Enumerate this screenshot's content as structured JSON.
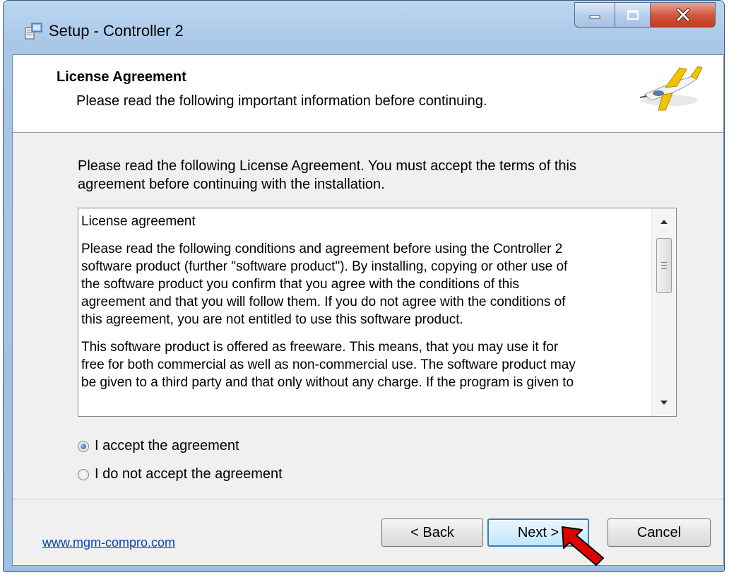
{
  "window": {
    "title": "Setup - Controller 2",
    "caption_buttons": [
      "minimize-icon",
      "maximize-icon",
      "close-icon"
    ]
  },
  "header": {
    "title": "License Agreement",
    "subtitle": "Please read the following important information before continuing.",
    "logo_icon": "airplane-icon"
  },
  "intro_text": "Please read the following License Agreement. You must accept the terms of this agreement before continuing with the installation.",
  "license": {
    "paragraphs": [
      "License agreement",
      "Please read the following conditions and agreement before using the Controller 2\nsoftware product (further \"software product\"). By installing, copying or other use of\nthe software product you confirm that you agree with the conditions of this\nagreement and that you will follow them. If you do not agree with the conditions of\nthis agreement, you are not entitled to use this software product.",
      "This software product is offered as freeware. This means, that you may use it for\nfree for both commercial as well as non-commercial use. The software product may\nbe given to a third party and that only without any charge. If the program is given to"
    ]
  },
  "options": {
    "accept": {
      "label": "I accept the agreement",
      "checked": true
    },
    "decline": {
      "label": "I do not accept the agreement",
      "checked": false
    }
  },
  "footer": {
    "website": "www.mgm-compro.com",
    "back_label": "< Back",
    "next_label": "Next >",
    "cancel_label": "Cancel"
  },
  "colors": {
    "accent": "#3c7fb1",
    "annotation_arrow": "#e00000",
    "link": "#0645ad"
  }
}
